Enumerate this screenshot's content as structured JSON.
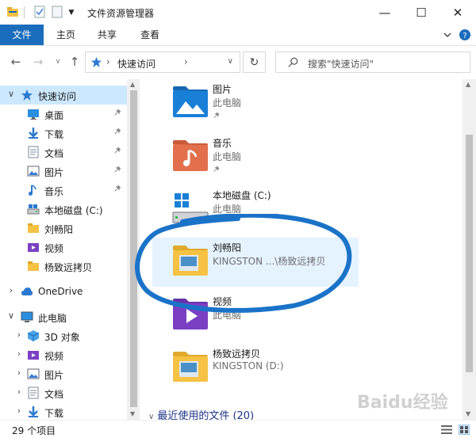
{
  "window": {
    "title": "文件资源管理器",
    "minimize_glyph": "—",
    "maximize_glyph": "☐",
    "close_glyph": "✕"
  },
  "ribbon": {
    "tabs": [
      "文件",
      "主页",
      "共享",
      "查看"
    ],
    "accent": "#1a6dbd"
  },
  "address": {
    "path": "快速访问",
    "separator": "›",
    "search_placeholder": "搜索\"快速访问\""
  },
  "nav_tree": [
    {
      "label": "快速访问",
      "icon": "star-icon",
      "level": 0,
      "expanded": true,
      "selected": true
    },
    {
      "label": "桌面",
      "icon": "desktop-icon",
      "level": 1,
      "pinned": true
    },
    {
      "label": "下载",
      "icon": "download-icon",
      "level": 1,
      "pinned": true
    },
    {
      "label": "文档",
      "icon": "document-icon",
      "level": 1,
      "pinned": true
    },
    {
      "label": "图片",
      "icon": "pictures-icon",
      "level": 1,
      "pinned": true
    },
    {
      "label": "音乐",
      "icon": "music-icon",
      "level": 1,
      "pinned": true
    },
    {
      "label": "本地磁盘 (C:)",
      "icon": "drive-icon",
      "level": 1
    },
    {
      "label": "刘畅阳",
      "icon": "folder-icon",
      "level": 1
    },
    {
      "label": "视频",
      "icon": "video-icon",
      "level": 1
    },
    {
      "label": "杨致远拷贝",
      "icon": "folder-icon",
      "level": 1
    },
    {
      "label": "OneDrive",
      "icon": "cloud-icon",
      "level": 0,
      "expanded": false
    },
    {
      "label": "此电脑",
      "icon": "computer-icon",
      "level": 0,
      "expanded": true
    },
    {
      "label": "3D 对象",
      "icon": "cube-icon",
      "level": 1
    },
    {
      "label": "视频",
      "icon": "video-icon",
      "level": 1
    },
    {
      "label": "图片",
      "icon": "pictures-icon",
      "level": 1
    },
    {
      "label": "文档",
      "icon": "document-icon",
      "level": 1
    },
    {
      "label": "下载",
      "icon": "download-icon",
      "level": 1
    }
  ],
  "tiles": [
    {
      "name": "图片",
      "sub": "此电脑",
      "icon": "pictures-folder-icon",
      "pinned": true
    },
    {
      "name": "音乐",
      "sub": "此电脑",
      "icon": "music-folder-icon",
      "pinned": true
    },
    {
      "name": "本地磁盘 (C:)",
      "sub": "此电脑",
      "icon": "drive-icon",
      "pinned": false
    },
    {
      "name": "刘畅阳",
      "sub": "KINGSTON ...\\杨致远拷贝",
      "icon": "folder-icon",
      "pinned": false,
      "highlighted": true
    },
    {
      "name": "视频",
      "sub": "此电脑",
      "icon": "video-folder-icon",
      "pinned": false
    },
    {
      "name": "杨致远拷贝",
      "sub": "KINGSTON (D:)",
      "icon": "folder-icon",
      "pinned": false
    }
  ],
  "recent": {
    "label": "最近使用的文件 (20)"
  },
  "status": {
    "item_count": "29 个项目"
  },
  "watermark": "Baidu经验"
}
